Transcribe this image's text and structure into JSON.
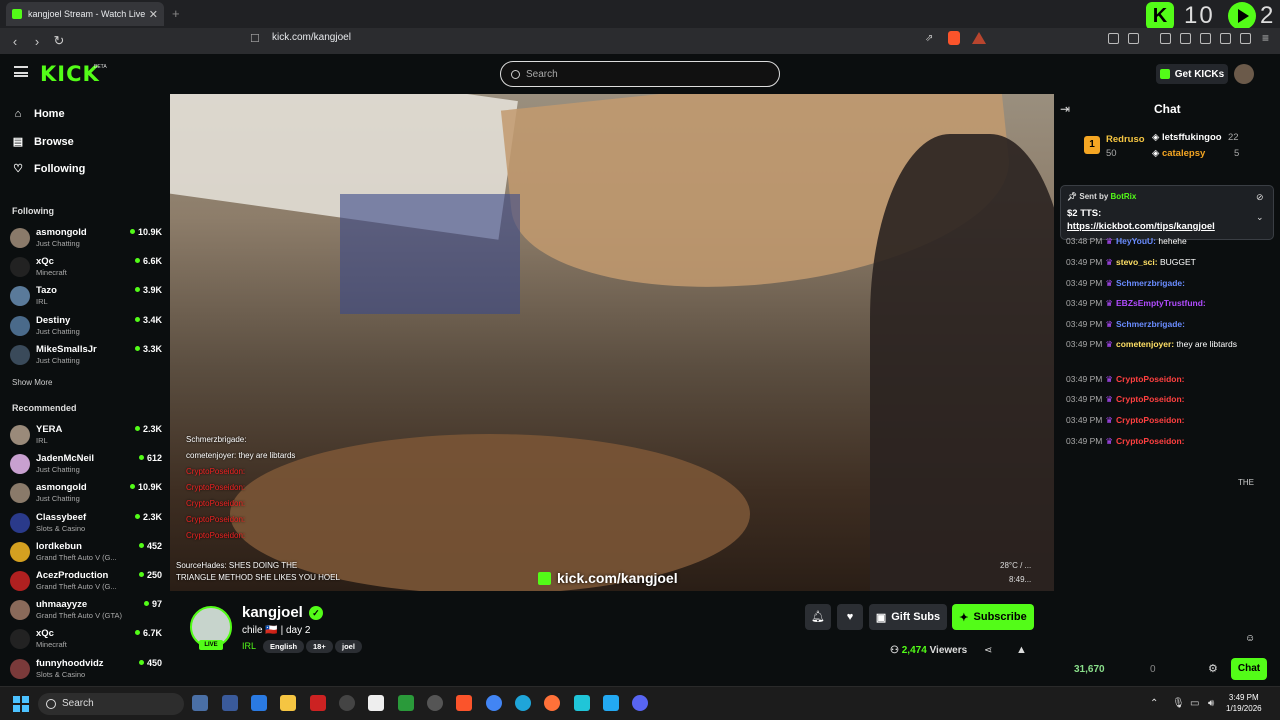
{
  "browser": {
    "tab_title": "kangjoel Stream - Watch Live",
    "url": "kick.com/kangjoel",
    "new_tab": "+",
    "tab_close": "✕",
    "badge_count": "10",
    "badge_count2": "2"
  },
  "header": {
    "logo": "KICK",
    "logo_beta": "BETA",
    "search_placeholder": "Search",
    "get_kicks": "Get KICKs"
  },
  "sidebar": {
    "nav": [
      {
        "label": "Home",
        "icon": "home-icon"
      },
      {
        "label": "Browse",
        "icon": "browse-icon"
      },
      {
        "label": "Following",
        "icon": "heart-icon"
      }
    ],
    "following_heading": "Following",
    "following": [
      {
        "name": "asmongold",
        "category": "Just Chatting",
        "viewers": "10.9K",
        "color": "#8a7a6a"
      },
      {
        "name": "xQc",
        "category": "Minecraft",
        "viewers": "6.6K",
        "color": "#222"
      },
      {
        "name": "Tazo",
        "category": "IRL",
        "viewers": "3.9K",
        "color": "#5a7a9a"
      },
      {
        "name": "Destiny",
        "category": "Just Chatting",
        "viewers": "3.4K",
        "color": "#4a6a8a"
      },
      {
        "name": "MikeSmallsJr",
        "category": "Just Chatting",
        "viewers": "3.3K",
        "color": "#3a4a5a"
      }
    ],
    "show_more": "Show More",
    "recommended_heading": "Recommended",
    "recommended": [
      {
        "name": "YERA",
        "category": "IRL",
        "viewers": "2.3K",
        "color": "#9a8a7a"
      },
      {
        "name": "JadenMcNeil",
        "category": "Just Chatting",
        "viewers": "612",
        "color": "#c8a0d0"
      },
      {
        "name": "asmongold",
        "category": "Just Chatting",
        "viewers": "10.9K",
        "color": "#8a7a6a"
      },
      {
        "name": "Classybeef",
        "category": "Slots & Casino",
        "viewers": "2.3K",
        "color": "#2a3a8a"
      },
      {
        "name": "lordkebun",
        "category": "Grand Theft Auto V (G...",
        "viewers": "452",
        "color": "#d4a020"
      },
      {
        "name": "AcezProduction",
        "category": "Grand Theft Auto V (G...",
        "viewers": "250",
        "color": "#b02020"
      },
      {
        "name": "uhmaayyze",
        "category": "Grand Theft Auto V (GTA)",
        "viewers": "97",
        "color": "#8a6a5a"
      },
      {
        "name": "xQc",
        "category": "Minecraft",
        "viewers": "6.7K",
        "color": "#222"
      },
      {
        "name": "funnyhoodvidz",
        "category": "Slots & Casino",
        "viewers": "450",
        "color": "#7a3a3a"
      }
    ]
  },
  "video": {
    "overlay_chat": [
      {
        "user": "Schmerzbrigade:",
        "text": "",
        "red": false
      },
      {
        "user": "cometenjoyer:",
        "text": "they are libtards",
        "red": false
      },
      {
        "user": "CryptoPoseidon:",
        "text": "",
        "red": true
      },
      {
        "user": "CryptoPoseidon:",
        "text": "",
        "red": true
      },
      {
        "user": "CryptoPoseidon:",
        "text": "",
        "red": true
      },
      {
        "user": "CryptoPoseidon:",
        "text": "",
        "red": true
      },
      {
        "user": "CryptoPoseidon:",
        "text": "",
        "red": true
      }
    ],
    "overlay_sub_line1": "SourceHades: SHES DOING THE",
    "overlay_sub_line2": "TRIANGLE METHOD SHE LIKES YOU HOEL",
    "watermark": "kick.com/kangjoel",
    "temp": "28°C / ...",
    "time": "8:49..."
  },
  "stream": {
    "name": "kangjoel",
    "live": "LIVE",
    "title": "chile 🇨🇱 | day 2",
    "category": "IRL",
    "tags": [
      "English",
      "18+",
      "joel"
    ],
    "gift_subs": "Gift Subs",
    "subscribe": "Subscribe",
    "viewers": "2,474",
    "viewers_label": "Viewers"
  },
  "chat": {
    "title": "Chat",
    "top_gifter": {
      "rank": "1",
      "name": "Redruso",
      "count": "50"
    },
    "gifters": [
      {
        "name": "letsffukingoo",
        "count": "22"
      },
      {
        "name": "catalepsy",
        "count": "5"
      }
    ],
    "pinned": {
      "sent_by_label": "Sent by",
      "bot": "BotRix",
      "line1": "$2 TTS:",
      "link": "https://kickbot.com/tips/kangjoel"
    },
    "messages": [
      {
        "time": "03:48 PM",
        "user": "HeyYouU:",
        "text": "hehehe",
        "color": "#6a8cff"
      },
      {
        "time": "03:49 PM",
        "user": "stevo_sci:",
        "text": "BUGGET",
        "color": "#ffe066"
      },
      {
        "time": "03:49 PM",
        "user": "Schmerzbrigade:",
        "text": "",
        "color": "#6a8cff"
      },
      {
        "time": "03:49 PM",
        "user": "EBZsEmptyTrustfund:",
        "text": "",
        "color": "#b14cff"
      },
      {
        "time": "03:49 PM",
        "user": "Schmerzbrigade:",
        "text": "",
        "color": "#6a8cff"
      },
      {
        "time": "03:49 PM",
        "user": "cometenjoyer:",
        "text": "they are libtards",
        "color": "#ffe066"
      },
      {
        "time": "03:49 PM",
        "user": "CryptoPoseidon:",
        "text": "",
        "color": "#ff4040"
      },
      {
        "time": "03:49 PM",
        "user": "CryptoPoseidon:",
        "text": "",
        "color": "#ff4040"
      },
      {
        "time": "03:49 PM",
        "user": "CryptoPoseidon:",
        "text": "",
        "color": "#ff4040"
      },
      {
        "time": "03:49 PM",
        "user": "CryptoPoseidon:",
        "text": "",
        "color": "#ff4040"
      }
    ],
    "points": "31,670",
    "points2": "0",
    "chat_button": "Chat",
    "overlay_the": "THE"
  },
  "taskbar": {
    "search": "Search",
    "time": "3:49 PM",
    "date": "1/19/2026"
  },
  "colors": {
    "accent": "#53fc18",
    "bg": "#0b0e0f"
  }
}
